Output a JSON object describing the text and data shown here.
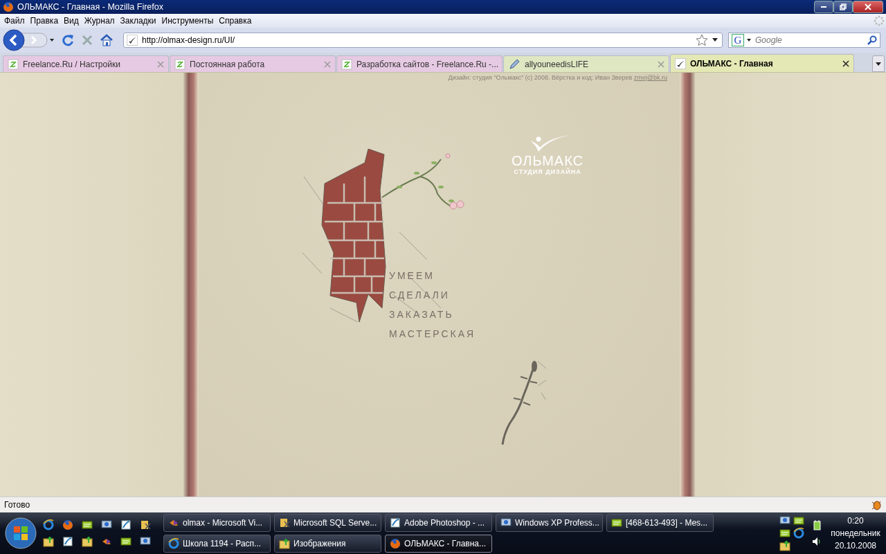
{
  "window": {
    "title": "ОЛЬМАКС - Главная - Mozilla Firefox"
  },
  "menu": [
    "Файл",
    "Правка",
    "Вид",
    "Журнал",
    "Закладки",
    "Инструменты",
    "Справка"
  ],
  "toolbar": {
    "url": "http://olmax-design.ru/UI/",
    "search_placeholder": "Google",
    "engine_letter": "G"
  },
  "tabs": [
    {
      "label": "Freelance.Ru / Настройки",
      "selected": false,
      "kind": "freelance"
    },
    {
      "label": "Постоянная работа",
      "selected": false,
      "kind": "freelance"
    },
    {
      "label": "Разработка сайтов - Freelance.Ru -...",
      "selected": false,
      "kind": "freelance"
    },
    {
      "label": "allyouneedisLIFE",
      "selected": false,
      "kind": "pencil"
    },
    {
      "label": "ОЛЬМАКС - Главная",
      "selected": true,
      "kind": "site"
    }
  ],
  "page": {
    "credit": "Дизайн: студия \"Ольмакс\" (с) 2008. Вёрстка и код: Иван Зверев ",
    "credit_email": "zmej@bk.ru",
    "logo_name": "ОЛЬМАКС",
    "logo_subtitle": "СТУДИЯ ДИЗАЙНА",
    "nav": [
      "УМЕЕМ",
      "СДЕЛАЛИ",
      "ЗАКАЗАТЬ",
      "МАСТЕРСКАЯ"
    ]
  },
  "status_bar": {
    "text": "Готово"
  },
  "taskbar": {
    "buttons": [
      {
        "label": "olmax - Microsoft Vi...",
        "selected": false,
        "kind": "vs"
      },
      {
        "label": "Microsoft SQL Serve...",
        "selected": false,
        "kind": "sql"
      },
      {
        "label": "Adobe Photoshop - ...",
        "selected": false,
        "kind": "ps"
      },
      {
        "label": "Windows XP Profess...",
        "selected": false,
        "kind": "vm"
      },
      {
        "label": "[468-613-493] - Mes...",
        "selected": false,
        "kind": "chat"
      },
      {
        "label": "Школа 1194 - Расп...",
        "selected": false,
        "kind": "ie"
      },
      {
        "label": "Изображения",
        "selected": false,
        "kind": "folder"
      },
      {
        "label": "ОЛЬМАКС - Главна...",
        "selected": true,
        "kind": "firefox"
      }
    ],
    "clock": {
      "time": "0:20",
      "day": "понедельник",
      "date": "20.10.2008"
    }
  }
}
